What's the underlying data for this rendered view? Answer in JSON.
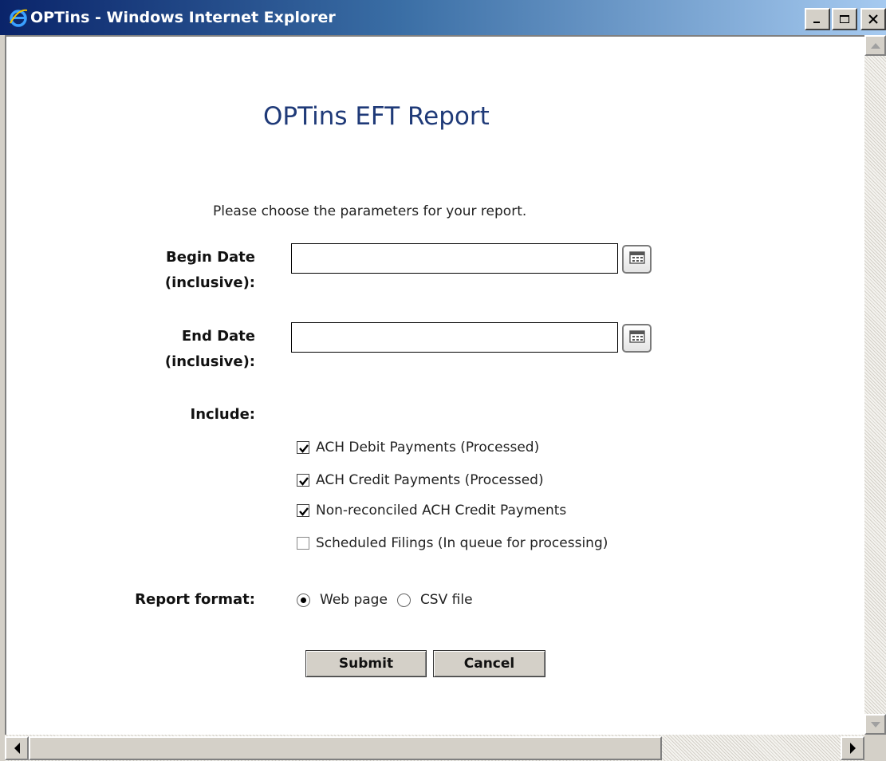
{
  "window": {
    "title": "OPTins - Windows Internet Explorer"
  },
  "page": {
    "title": "OPTins EFT Report",
    "instructions": "Please choose the parameters for your report."
  },
  "form": {
    "begin_date_label": "Begin Date (inclusive):",
    "begin_date_value": "",
    "end_date_label": "End Date (inclusive):",
    "end_date_value": "",
    "include_label": "Include:",
    "include_options": [
      {
        "label": "ACH Debit Payments (Processed)",
        "checked": true
      },
      {
        "label": "ACH Credit Payments (Processed)",
        "checked": true
      },
      {
        "label": "Non-reconciled ACH Credit Payments",
        "checked": true
      },
      {
        "label": "Scheduled Filings (In queue for processing)",
        "checked": false
      }
    ],
    "report_format_label": "Report format:",
    "report_formats": [
      {
        "label": "Web page",
        "selected": true
      },
      {
        "label": "CSV file",
        "selected": false
      }
    ],
    "submit_label": "Submit",
    "cancel_label": "Cancel"
  },
  "icons": {
    "browser": "ie-icon",
    "calendar": "calendar-icon",
    "minimize": "minimize-icon",
    "maximize": "maximize-icon",
    "close": "close-icon"
  },
  "colors": {
    "title_bar": "#0a246a",
    "page_title": "#1f3a78",
    "chrome": "#d4d0c8"
  }
}
